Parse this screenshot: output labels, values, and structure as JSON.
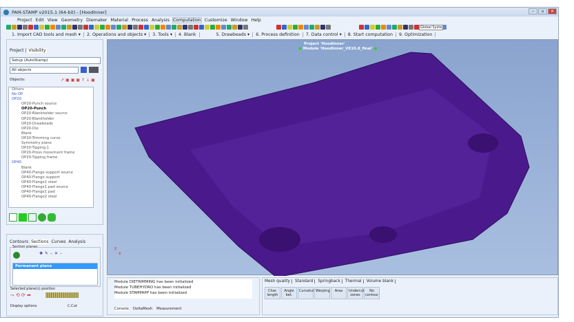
{
  "window": {
    "title": "PAM-STAMP v2015.1 (64-bit) - [HoodInner]"
  },
  "menu": [
    "Project",
    "Edit",
    "View",
    "Geometry",
    "Diemaker",
    "Material",
    "Process",
    "Analysis",
    "Computation",
    "Customize",
    "Window",
    "Help"
  ],
  "process_tabs": [
    "1. Import CAD tools and mesh ▾",
    "2. Operations and objects ▾",
    "3. Tools ▾",
    "4. Blank",
    "5. Drawbeads ▾",
    "6. Process definition",
    "7. Data control ▾",
    "8. Start computation",
    "9. Optimization"
  ],
  "coord_system": "Global Syste",
  "left_panel": {
    "tabs": [
      "Project",
      "Visibility"
    ],
    "setup_select": "Setup (AutoStamp)",
    "filter_select": "All objects",
    "objects_label": "Objects:",
    "tree": [
      {
        "t": "Others",
        "l": 0
      },
      {
        "t": "No OP",
        "l": 0,
        "g": 1
      },
      {
        "t": "OP20",
        "l": 0,
        "g": 1
      },
      {
        "t": "OP20-Punch source",
        "l": 1
      },
      {
        "t": "OP20-Punch",
        "l": 1,
        "b": 1
      },
      {
        "t": "OP20-Blankholder source",
        "l": 1
      },
      {
        "t": "OP20-Blankholder",
        "l": 1
      },
      {
        "t": "OP20-Drawbeads",
        "l": 1
      },
      {
        "t": "OP20-Die",
        "l": 1
      },
      {
        "t": "Blank",
        "l": 1
      },
      {
        "t": "OP20-Trimming curve",
        "l": 1
      },
      {
        "t": "Symmetry plane",
        "l": 1
      },
      {
        "t": "OP20-Tipping.1",
        "l": 1
      },
      {
        "t": "OP20-Press movement frame",
        "l": 1
      },
      {
        "t": "OP20-Tipping frame",
        "l": 1
      },
      {
        "t": "OP40",
        "l": 0,
        "g": 1
      },
      {
        "t": "Blank",
        "l": 1
      },
      {
        "t": "OP40-Flange support source",
        "l": 1
      },
      {
        "t": "OP40-Flange support",
        "l": 1
      },
      {
        "t": "OP40-Flange1 steel",
        "l": 1
      },
      {
        "t": "OP40-Flange1 pad source",
        "l": 1
      },
      {
        "t": "OP40-Flange1 pad",
        "l": 1
      },
      {
        "t": "OP40-Flange2 steel",
        "l": 1
      }
    ]
  },
  "sections_panel": {
    "tabs": [
      "Contours",
      "Sections",
      "Curves",
      "Analysis"
    ],
    "group": "Section planes",
    "planes": [
      "Permanent plane"
    ],
    "position_label": "Selected plane(s) position",
    "display_label": "Display options",
    "ccut_label": "C.Cut"
  },
  "viewport": {
    "project": "Project 'HoodInner'",
    "module": "Module 'HoodInner_VE10.8_final'",
    "axis_x": "x",
    "axis_z": "z",
    "hood_color": "#4a1a8c"
  },
  "console": {
    "lines": [
      "Module DIETRIMMING has been initialized",
      "Module TUBEHYDRO has been initialized",
      "Module STAMPAPP has been initialized"
    ],
    "tabs": [
      "Console",
      "DeltaMesh",
      "Measurement"
    ]
  },
  "mesh_panel": {
    "tabs": [
      "Mesh quality",
      "Standard",
      "Springback",
      "Thermal",
      "Volume blank"
    ],
    "buttons": [
      "Char. length",
      "Angle bet.",
      "Curvature",
      "Warping",
      "Area",
      "Undercut zones",
      "No contour"
    ]
  }
}
